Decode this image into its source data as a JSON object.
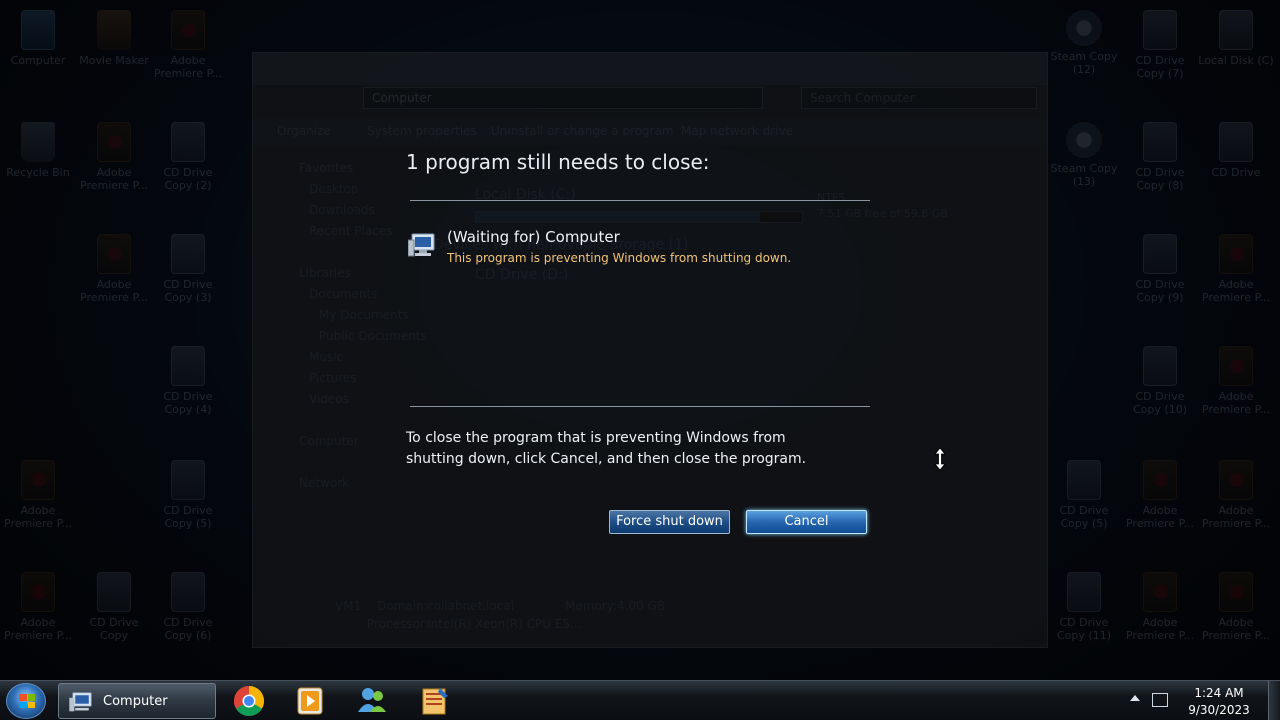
{
  "desktop": {
    "icons": [
      {
        "label": "Computer",
        "type": "pc"
      },
      {
        "label": "Movie Maker",
        "type": "film"
      },
      {
        "label": "Adobe Premiere P...",
        "type": "premiere"
      },
      {
        "label": "Recycle Bin",
        "type": "bin"
      },
      {
        "label": "Adobe Premiere P...",
        "type": "premiere"
      },
      {
        "label": "CD Drive Copy (2)",
        "type": "cd"
      },
      {
        "label": "Adobe Premiere P...",
        "type": "premiere"
      },
      {
        "label": "CD Drive Copy (3)",
        "type": "cd"
      },
      {
        "label": "CD Drive Copy (4)",
        "type": "cd"
      },
      {
        "label": "Adobe Premiere P...",
        "type": "premiere"
      },
      {
        "label": "CD Drive Copy (5)",
        "type": "cd"
      },
      {
        "label": "Adobe Premiere P...",
        "type": "premiere"
      },
      {
        "label": "CD Drive Copy",
        "type": "cd"
      },
      {
        "label": "CD Drive Copy (6)",
        "type": "cd"
      },
      {
        "label": "Steam Copy (12)",
        "type": "steam"
      },
      {
        "label": "CD Drive Copy (7)",
        "type": "cd"
      },
      {
        "label": "Local Disk (C)",
        "type": "cd"
      },
      {
        "label": "Steam Copy (13)",
        "type": "steam"
      },
      {
        "label": "CD Drive Copy (8)",
        "type": "cd"
      },
      {
        "label": "CD Drive",
        "type": "cd"
      },
      {
        "label": "CD Drive Copy (9)",
        "type": "cd"
      },
      {
        "label": "Adobe Premiere P...",
        "type": "premiere"
      },
      {
        "label": "CD Drive Copy (10)",
        "type": "cd"
      },
      {
        "label": "Adobe Premiere P...",
        "type": "premiere"
      },
      {
        "label": "CD Drive Copy (5)",
        "type": "cd"
      },
      {
        "label": "Adobe Premiere P...",
        "type": "premiere"
      },
      {
        "label": "Adobe Premiere P...",
        "type": "premiere"
      },
      {
        "label": "CD Drive Copy (11)",
        "type": "cd"
      },
      {
        "label": "Adobe Premiere P...",
        "type": "premiere"
      },
      {
        "label": "Adobe Premiere P...",
        "type": "premiere"
      }
    ]
  },
  "explorer": {
    "address": "Computer",
    "search_placeholder": "Search Computer",
    "toolbar": [
      "Organize",
      "System properties",
      "Uninstall or change a program",
      "Map network drive"
    ],
    "nav": [
      "Favorites",
      "Desktop",
      "Downloads",
      "Recent Places",
      "Libraries",
      "Documents",
      "My Documents",
      "Public Documents",
      "Music",
      "Pictures",
      "Videos",
      "Computer",
      "Network"
    ],
    "drives": {
      "local_disk": "Local Disk (C:)",
      "fs": "NTFS",
      "free": "7.51 GB free of 59.8 GB",
      "removable": "Devices with Removable Storage (1)",
      "cd": "CD Drive (D:)",
      "used_fraction": 0.87
    },
    "details": {
      "name": "VM1",
      "domain_label": "Domain:",
      "domain": "collabnet.local",
      "memory_label": "Memory:",
      "memory": "4.00 GB",
      "processor_label": "Processor:",
      "processor": "Intel(R) Xeon(R) CPU E5..."
    }
  },
  "dialog": {
    "title": "1 program still needs to close:",
    "program_name": "(Waiting for) Computer",
    "program_desc": "This program is preventing Windows from shutting down.",
    "instructions": "To close the program that is preventing Windows from shutting down, click Cancel, and then close the program.",
    "force_label": "Force shut down",
    "cancel_label": "Cancel"
  },
  "taskbar": {
    "active_label": "Computer",
    "time": "1:24 AM",
    "date": "9/30/2023"
  },
  "colors": {
    "warning_text": "#f3c47a",
    "button_blue": "#1f4f86",
    "focus_glow": "#7fd2ff"
  }
}
